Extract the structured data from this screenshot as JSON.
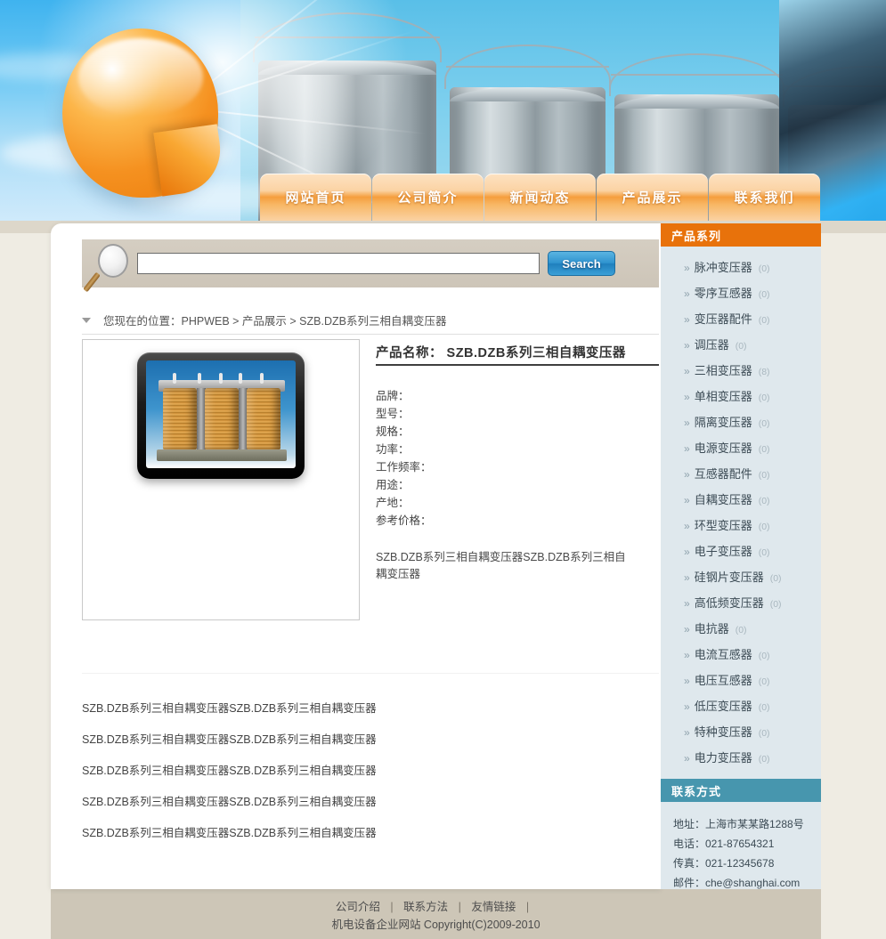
{
  "site": {
    "logo_alt": "orange-sticker-logo",
    "banner_alt": "industrial-storage-silos"
  },
  "nav": {
    "items": [
      {
        "label": "网站首页"
      },
      {
        "label": "公司简介"
      },
      {
        "label": "新闻动态"
      },
      {
        "label": "产品展示"
      },
      {
        "label": "联系我们"
      }
    ]
  },
  "search": {
    "value": "",
    "placeholder": "",
    "button_label": "Search"
  },
  "breadcrumb": {
    "text": "您现在的位置：PHPWEB > 产品展示  > SZB.DZB系列三相自耦变压器"
  },
  "product": {
    "title": "产品名称： SZB.DZB系列三相自耦变压器",
    "specs": [
      {
        "label": "品牌："
      },
      {
        "label": "型号："
      },
      {
        "label": "规格："
      },
      {
        "label": "功率："
      },
      {
        "label": "工作频率："
      },
      {
        "label": "用途："
      },
      {
        "label": "产地："
      },
      {
        "label": "参考价格："
      }
    ],
    "description": "SZB.DZB系列三相自耦变压器SZB.DZB系列三相自耦变压器",
    "image_alt": "three-phase-autotransformer-photo"
  },
  "related": {
    "items": [
      {
        "text": "SZB.DZB系列三相自耦变压器SZB.DZB系列三相自耦变压器"
      },
      {
        "text": "SZB.DZB系列三相自耦变压器SZB.DZB系列三相自耦变压器"
      },
      {
        "text": "SZB.DZB系列三相自耦变压器SZB.DZB系列三相自耦变压器"
      },
      {
        "text": "SZB.DZB系列三相自耦变压器SZB.DZB系列三相自耦变压器"
      },
      {
        "text": "SZB.DZB系列三相自耦变压器SZB.DZB系列三相自耦变压器"
      }
    ]
  },
  "sidebar": {
    "categories_title": "产品系列",
    "categories": [
      {
        "label": "脉冲变压器",
        "count": "(0)"
      },
      {
        "label": "零序互感器",
        "count": "(0)"
      },
      {
        "label": "变压器配件",
        "count": "(0)"
      },
      {
        "label": "调压器",
        "count": "(0)"
      },
      {
        "label": "三相变压器",
        "count": "(8)"
      },
      {
        "label": "单相变压器",
        "count": "(0)"
      },
      {
        "label": "隔离变压器",
        "count": "(0)"
      },
      {
        "label": "电源变压器",
        "count": "(0)"
      },
      {
        "label": "互感器配件",
        "count": "(0)"
      },
      {
        "label": "自耦变压器",
        "count": "(0)"
      },
      {
        "label": "环型变压器",
        "count": "(0)"
      },
      {
        "label": "电子变压器",
        "count": "(0)"
      },
      {
        "label": "硅钢片变压器",
        "count": "(0)"
      },
      {
        "label": "高低频变压器",
        "count": "(0)"
      },
      {
        "label": "电抗器",
        "count": "(0)"
      },
      {
        "label": "电流互感器",
        "count": "(0)"
      },
      {
        "label": "电压互感器",
        "count": "(0)"
      },
      {
        "label": "低压变压器",
        "count": "(0)"
      },
      {
        "label": "特种变压器",
        "count": "(0)"
      },
      {
        "label": "电力变压器",
        "count": "(0)"
      }
    ],
    "contact_title": "联系方式",
    "contact": [
      {
        "text": "地址：上海市某某路1288号"
      },
      {
        "text": "电话：021-87654321"
      },
      {
        "text": "传真：021-12345678"
      },
      {
        "text": "邮件：che@shanghai.com"
      }
    ]
  },
  "footer": {
    "links": [
      {
        "label": "公司介绍"
      },
      {
        "label": "联系方法"
      },
      {
        "label": "友情链接"
      }
    ],
    "separator": "|",
    "copyright": "机电设备企业网站  Copyright(C)2009-2010"
  },
  "colors": {
    "accent_orange": "#e8720b",
    "accent_teal": "#4796ae",
    "nav_orange": "#f59e3d",
    "search_button_blue": "#2f93cf",
    "sidebar_bg": "#dfe8ed",
    "page_bg": "#efece3",
    "footer_bg": "#cdc6b7"
  }
}
